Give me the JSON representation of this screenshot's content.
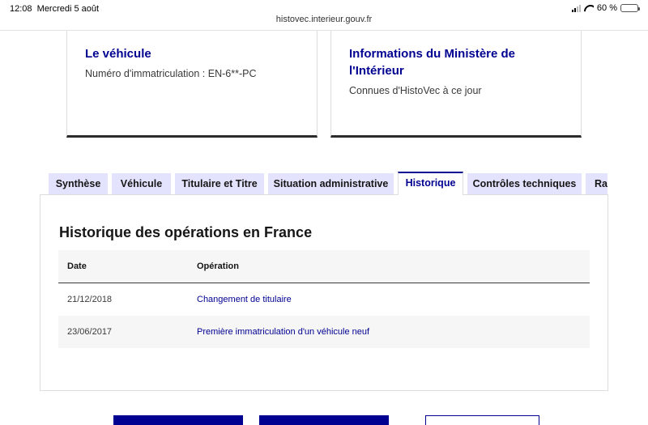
{
  "status": {
    "time": "12:08",
    "date": "Mercredi 5 août",
    "battery": "60 %",
    "battery_level": 0.6
  },
  "browser": {
    "url": "histovec.interieur.gouv.fr"
  },
  "cards": {
    "vehicle": {
      "title": "Le véhicule",
      "text": "Numéro d'immatriculation : EN-6**-PC"
    },
    "ministry": {
      "title": "Informations du Ministère de l'Intérieur",
      "text": "Connues d'HistoVec à ce jour"
    }
  },
  "tabs": [
    {
      "label": "Synthèse",
      "active": false
    },
    {
      "label": "Véhicule",
      "active": false
    },
    {
      "label": "Titulaire et Titre",
      "active": false
    },
    {
      "label": "Situation administrative",
      "active": false
    },
    {
      "label": "Historique",
      "active": true
    },
    {
      "label": "Contrôles techniques",
      "active": false
    },
    {
      "label": "Rap",
      "active": false
    }
  ],
  "panel": {
    "title": "Historique des opérations en France",
    "columns": [
      "Date",
      "Opération"
    ],
    "rows": [
      {
        "date": "21/12/2018",
        "operation": "Changement de titulaire"
      },
      {
        "date": "23/06/2017",
        "operation": "Première immatriculation d'un véhicule neuf"
      }
    ]
  },
  "colors": {
    "primary": "#000091",
    "tab_bg": "#e3e3fd",
    "row_alt": "#f6f6f6",
    "card_border": "#2b2b2b"
  }
}
